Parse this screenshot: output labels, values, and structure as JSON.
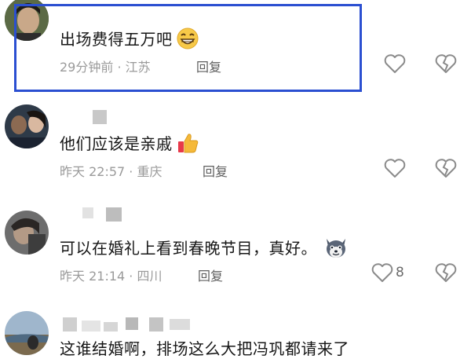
{
  "comments": [
    {
      "text": "出场费得五万吧",
      "emoji": "grinning-face-icon",
      "time": "29分钟前",
      "location": "江苏",
      "reply_label": "回复",
      "like_count": ""
    },
    {
      "text": "他们应该是亲戚",
      "emoji": "thumbs-up-icon",
      "time": "昨天 22:57",
      "location": "重庆",
      "reply_label": "回复",
      "like_count": ""
    },
    {
      "text": "可以在婚礼上看到春晚节目，真好。",
      "emoji": "husky-dog-icon",
      "time": "昨天 21:14",
      "location": "四川",
      "reply_label": "回复",
      "like_count": "8"
    },
    {
      "text": "这谁结婚啊，排场这么大把冯巩都请来了",
      "emoji": "",
      "time": "",
      "location": "",
      "reply_label": "",
      "like_count": ""
    }
  ],
  "meta_separator": "·",
  "colors": {
    "highlight_border": "#2b4fd1",
    "text": "#161616",
    "meta": "#9a9a9a",
    "icon": "#8a8a8a"
  }
}
